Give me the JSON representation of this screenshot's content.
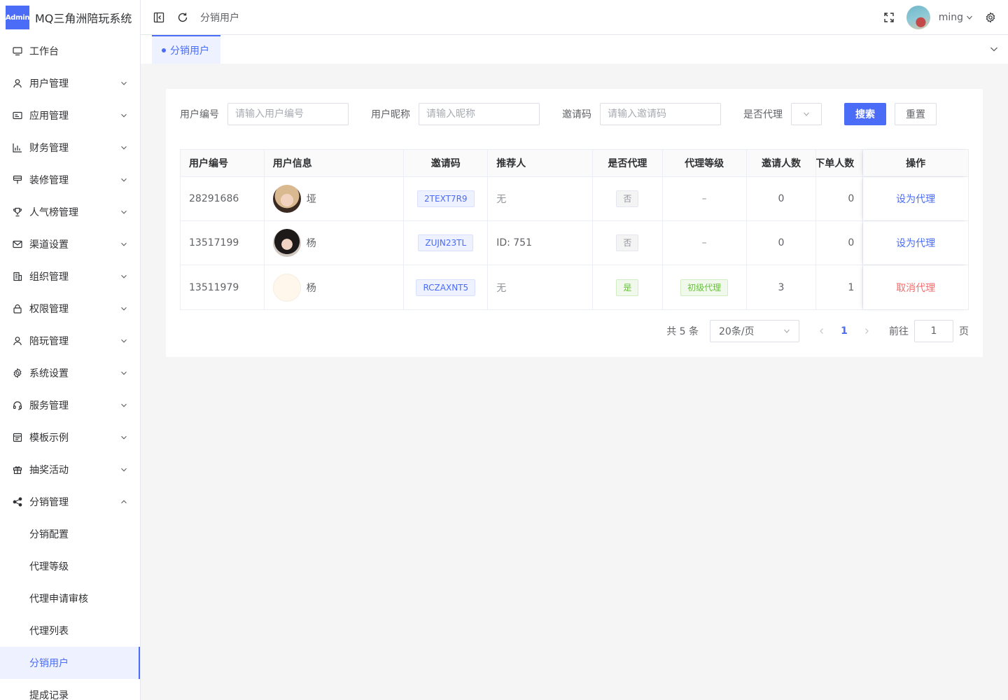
{
  "app": {
    "badge": "Admin",
    "title": "MQ三角洲陪玩系统"
  },
  "sidebar": {
    "items": [
      {
        "label": "工作台",
        "icon": "monitor-icon",
        "hasArrow": false
      },
      {
        "label": "用户管理",
        "icon": "user-icon",
        "hasArrow": true
      },
      {
        "label": "应用管理",
        "icon": "app-icon",
        "hasArrow": true
      },
      {
        "label": "财务管理",
        "icon": "chart-icon",
        "hasArrow": true
      },
      {
        "label": "装修管理",
        "icon": "brush-icon",
        "hasArrow": true
      },
      {
        "label": "人气榜管理",
        "icon": "trophy-icon",
        "hasArrow": true
      },
      {
        "label": "渠道设置",
        "icon": "mail-icon",
        "hasArrow": true
      },
      {
        "label": "组织管理",
        "icon": "office-icon",
        "hasArrow": true
      },
      {
        "label": "权限管理",
        "icon": "lock-icon",
        "hasArrow": true
      },
      {
        "label": "陪玩管理",
        "icon": "user-icon",
        "hasArrow": true
      },
      {
        "label": "系统设置",
        "icon": "gear-icon",
        "hasArrow": true
      },
      {
        "label": "服务管理",
        "icon": "headset-icon",
        "hasArrow": true
      },
      {
        "label": "模板示例",
        "icon": "template-icon",
        "hasArrow": true
      },
      {
        "label": "抽奖活动",
        "icon": "gift-icon",
        "hasArrow": true
      },
      {
        "label": "分销管理",
        "icon": "share-icon",
        "hasArrow": true,
        "expanded": true
      }
    ],
    "subitems": [
      {
        "label": "分销配置"
      },
      {
        "label": "代理等级"
      },
      {
        "label": "代理申请审核"
      },
      {
        "label": "代理列表"
      },
      {
        "label": "分销用户",
        "active": true
      },
      {
        "label": "提成记录"
      }
    ]
  },
  "header": {
    "breadcrumb": "分销用户",
    "username": "ming"
  },
  "tabs": [
    {
      "label": "分销用户"
    }
  ],
  "filters": {
    "user_id": {
      "label": "用户编号",
      "placeholder": "请输入用户编号"
    },
    "nickname": {
      "label": "用户昵称",
      "placeholder": "请输入昵称"
    },
    "invite_code": {
      "label": "邀请码",
      "placeholder": "请输入邀请码"
    },
    "is_agent": {
      "label": "是否代理"
    },
    "search_label": "搜索",
    "reset_label": "重置"
  },
  "table": {
    "columns": [
      "用户编号",
      "用户信息",
      "邀请码",
      "推荐人",
      "是否代理",
      "代理等级",
      "邀请人数",
      "下单人数",
      "操作"
    ],
    "rows": [
      {
        "id": "28291686",
        "name": "垭",
        "code": "2TEXT7R9",
        "referrer": "无",
        "is_agent": "否",
        "level": "–",
        "invites": "0",
        "orders": "0",
        "action": "设为代理"
      },
      {
        "id": "13517199",
        "name": "杨",
        "code": "ZUJN23TL",
        "referrer": "ID: 751",
        "is_agent": "否",
        "level": "–",
        "invites": "0",
        "orders": "0",
        "action": "设为代理"
      },
      {
        "id": "13511979",
        "name": "杨",
        "code": "RCZAXNT5",
        "referrer": "无",
        "is_agent": "是",
        "level": "初级代理",
        "invites": "3",
        "orders": "1",
        "action": "取消代理"
      }
    ]
  },
  "pagination": {
    "total": "共 5 条",
    "page_size": "20条/页",
    "current": "1",
    "goto_prefix": "前往",
    "goto_value": "1",
    "goto_suffix": "页"
  },
  "colors": {
    "accent": "#4a6cf7",
    "success": "#67c23a",
    "danger": "#f56c6c"
  }
}
